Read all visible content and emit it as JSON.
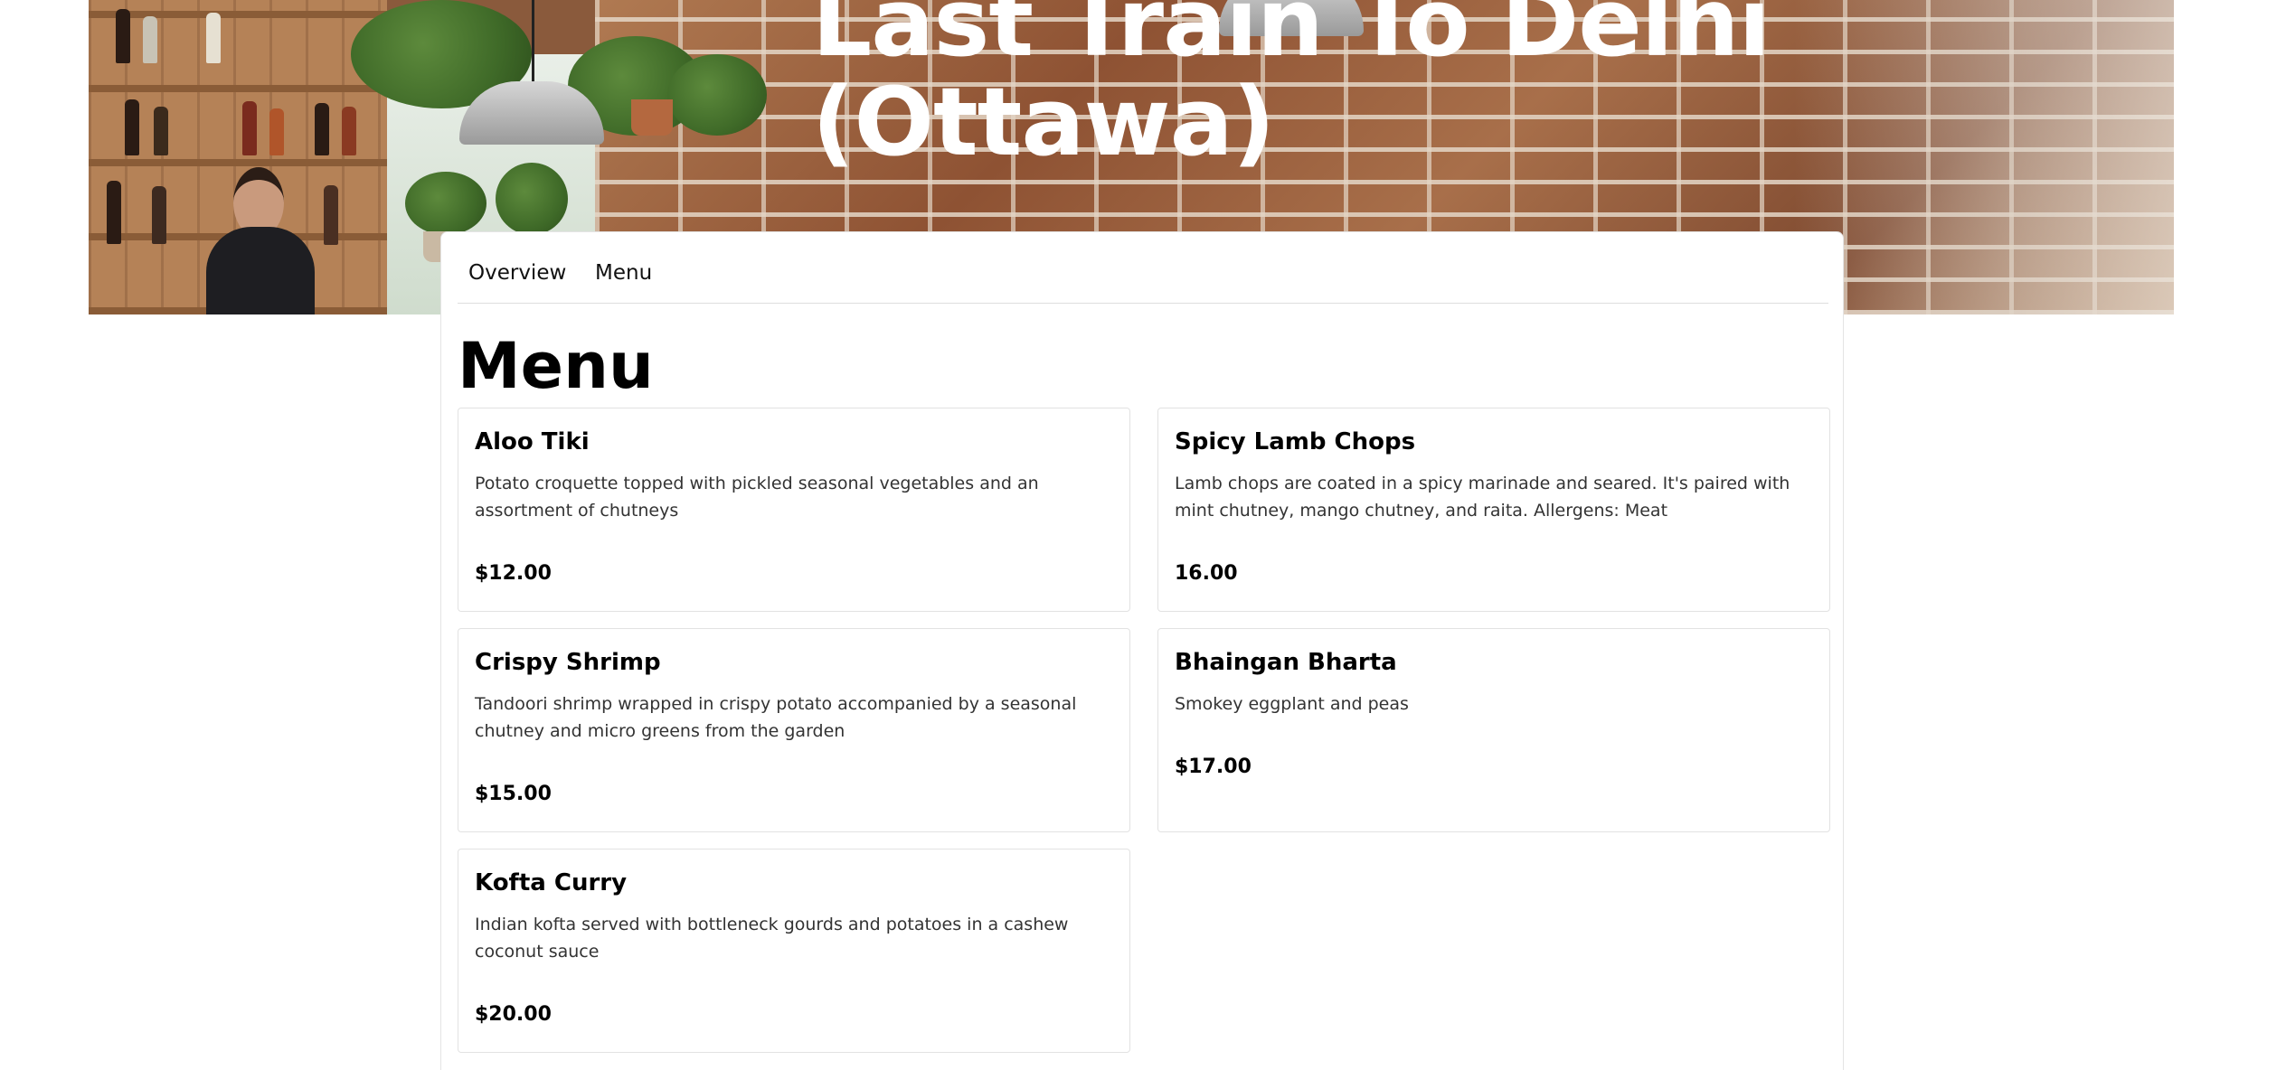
{
  "hero": {
    "title": "Last Train To Delhi (Ottawa)"
  },
  "nav": {
    "tabs": [
      {
        "label": "Overview"
      },
      {
        "label": "Menu"
      }
    ]
  },
  "menu": {
    "heading": "Menu",
    "items": [
      {
        "name": "Aloo Tiki",
        "description": "Potato croquette topped with pickled seasonal vegetables and an assortment of chutneys",
        "price": "$12.00"
      },
      {
        "name": "Spicy Lamb Chops",
        "description": "Lamb chops are coated in a spicy marinade and seared. It's paired with mint chutney, mango chutney, and raita. Allergens: Meat",
        "price": "16.00"
      },
      {
        "name": "Crispy Shrimp",
        "description": "Tandoori shrimp wrapped in crispy potato accompanied by a seasonal chutney and micro greens from the garden",
        "price": "$15.00"
      },
      {
        "name": "Bhaingan Bharta",
        "description": "Smokey eggplant and peas",
        "price": "$17.00"
      },
      {
        "name": "Kofta Curry",
        "description": "Indian kofta served with bottleneck gourds and potatoes in a cashew coconut sauce",
        "price": "$20.00"
      }
    ]
  }
}
